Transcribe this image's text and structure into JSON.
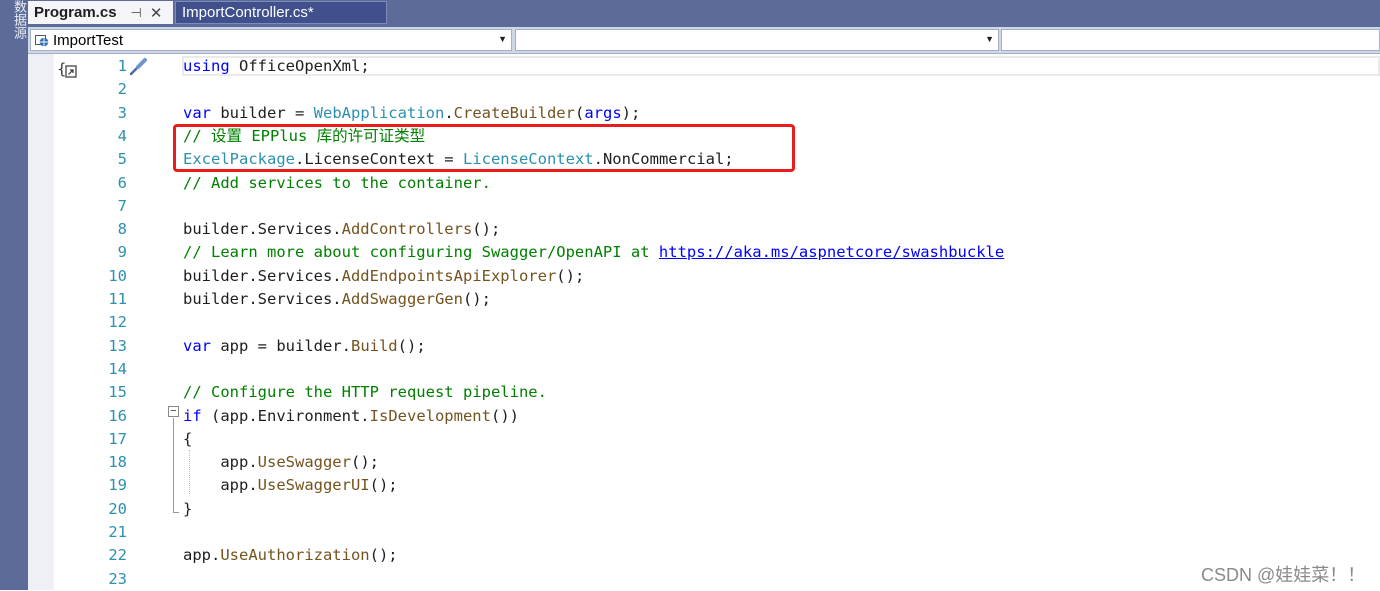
{
  "side_panel": {
    "label": "数据源"
  },
  "tabs": [
    {
      "label": "Program.cs",
      "active": true
    },
    {
      "label": "ImportController.cs*",
      "active": false
    }
  ],
  "navbar": {
    "project": "ImportTest",
    "type": "",
    "member": ""
  },
  "editor": {
    "line_numbers": [
      "1",
      "2",
      "3",
      "4",
      "5",
      "6",
      "7",
      "8",
      "9",
      "10",
      "11",
      "12",
      "13",
      "14",
      "15",
      "16",
      "17",
      "18",
      "19",
      "20",
      "21",
      "22",
      "23"
    ],
    "lines": [
      [
        {
          "t": "using",
          "c": "kw"
        },
        {
          "t": " OfficeOpenXml;"
        }
      ],
      [],
      [
        {
          "t": "var",
          "c": "kw"
        },
        {
          "t": " builder = "
        },
        {
          "t": "WebApplication",
          "c": "ty"
        },
        {
          "t": "."
        },
        {
          "t": "CreateBuilder",
          "c": "mt"
        },
        {
          "t": "("
        },
        {
          "t": "args",
          "c": "kw"
        },
        {
          "t": ");"
        }
      ],
      [
        {
          "t": "// 设置 EPPlus 库的许可证类型",
          "c": "cm"
        }
      ],
      [
        {
          "t": "ExcelPackage",
          "c": "ty"
        },
        {
          "t": ".LicenseContext = "
        },
        {
          "t": "LicenseContext",
          "c": "ty"
        },
        {
          "t": ".NonCommercial;"
        }
      ],
      [
        {
          "t": "// Add services to the container.",
          "c": "cm"
        }
      ],
      [],
      [
        {
          "t": "builder.Services."
        },
        {
          "t": "AddControllers",
          "c": "mt"
        },
        {
          "t": "();"
        }
      ],
      [
        {
          "t": "// Learn more about configuring Swagger/OpenAPI at ",
          "c": "cm"
        },
        {
          "t": "https://aka.ms/aspnetcore/swashbuckle",
          "c": "lk"
        }
      ],
      [
        {
          "t": "builder.Services."
        },
        {
          "t": "AddEndpointsApiExplorer",
          "c": "mt"
        },
        {
          "t": "();"
        }
      ],
      [
        {
          "t": "builder.Services."
        },
        {
          "t": "AddSwaggerGen",
          "c": "mt"
        },
        {
          "t": "();"
        }
      ],
      [],
      [
        {
          "t": "var",
          "c": "kw"
        },
        {
          "t": " app = builder."
        },
        {
          "t": "Build",
          "c": "mt"
        },
        {
          "t": "();"
        }
      ],
      [],
      [
        {
          "t": "// Configure the HTTP request pipeline.",
          "c": "cm"
        }
      ],
      [
        {
          "t": "if",
          "c": "kw"
        },
        {
          "t": " (app.Environment."
        },
        {
          "t": "IsDevelopment",
          "c": "mt"
        },
        {
          "t": "())"
        }
      ],
      [
        {
          "t": "{"
        }
      ],
      [
        {
          "t": "    app."
        },
        {
          "t": "UseSwagger",
          "c": "mt"
        },
        {
          "t": "();"
        }
      ],
      [
        {
          "t": "    app."
        },
        {
          "t": "UseSwaggerUI",
          "c": "mt"
        },
        {
          "t": "();"
        }
      ],
      [
        {
          "t": "}"
        }
      ],
      [],
      [
        {
          "t": "app."
        },
        {
          "t": "UseAuthorization",
          "c": "mt"
        },
        {
          "t": "();"
        }
      ],
      []
    ]
  },
  "watermark": "CSDN @娃娃菜！！"
}
